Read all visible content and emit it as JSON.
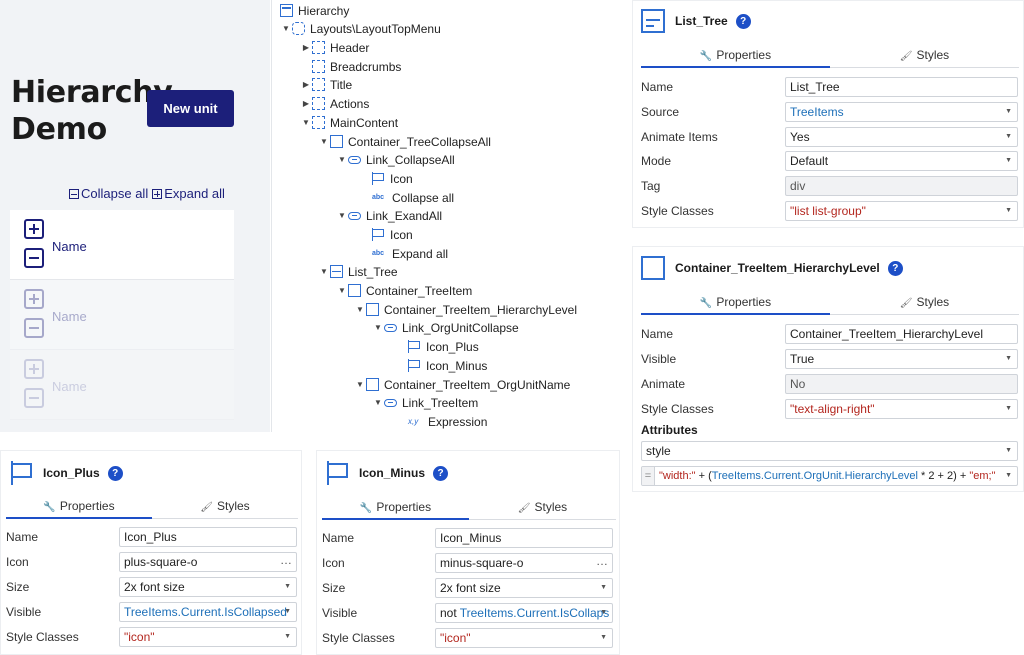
{
  "preview": {
    "title_line1": "Hierarchy",
    "title_line2": "Demo",
    "new_unit_label": "New unit",
    "collapse_all": "Collapse all",
    "expand_all": "Expand all",
    "rows": [
      {
        "name": "Name"
      },
      {
        "name": "Name"
      },
      {
        "name": "Name"
      }
    ]
  },
  "hierarchy": {
    "root": "Hierarchy",
    "nodes": [
      {
        "label": "Layouts\\LayoutTopMenu"
      },
      {
        "label": "Header"
      },
      {
        "label": "Breadcrumbs"
      },
      {
        "label": "Title"
      },
      {
        "label": "Actions"
      },
      {
        "label": "MainContent"
      },
      {
        "label": "Container_TreeCollapseAll"
      },
      {
        "label": "Link_CollapseAll"
      },
      {
        "label": "Icon"
      },
      {
        "label": "Collapse all"
      },
      {
        "label": "Link_ExandAll"
      },
      {
        "label": "Icon"
      },
      {
        "label": "Expand all"
      },
      {
        "label": "List_Tree"
      },
      {
        "label": "Container_TreeItem"
      },
      {
        "label": "Container_TreeItem_HierarchyLevel"
      },
      {
        "label": "Link_OrgUnitCollapse"
      },
      {
        "label": "Icon_Plus"
      },
      {
        "label": "Icon_Minus"
      },
      {
        "label": "Container_TreeItem_OrgUnitName"
      },
      {
        "label": "Link_TreeItem"
      },
      {
        "label": "Expression"
      }
    ]
  },
  "common": {
    "properties_tab": "Properties",
    "styles_tab": "Styles",
    "help": "?",
    "abc": "abc",
    "xy": "x,y"
  },
  "list_tree": {
    "title": "List_Tree",
    "labels": {
      "name": "Name",
      "source": "Source",
      "animate": "Animate Items",
      "mode": "Mode",
      "tag": "Tag",
      "style": "Style Classes"
    },
    "values": {
      "name": "List_Tree",
      "source": "TreeItems",
      "animate": "Yes",
      "mode": "Default",
      "tag": "div",
      "style": "\"list list-group\""
    }
  },
  "hier_level": {
    "title": "Container_TreeItem_HierarchyLevel",
    "labels": {
      "name": "Name",
      "visible": "Visible",
      "animate": "Animate",
      "style": "Style Classes"
    },
    "values": {
      "name": "Container_TreeItem_HierarchyLevel",
      "visible": "True",
      "animate": "No",
      "style": "\"text-align-right\""
    },
    "attributes_label": "Attributes",
    "attr_name": "style",
    "expr": {
      "s1": "\"width:\"",
      "k1": "+ (",
      "b1": "TreeItems.Current.OrgUnit.HierarchyLevel",
      "k2": "* 2 + 2) +",
      "s2": "\"em;\""
    }
  },
  "icon_plus": {
    "title": "Icon_Plus",
    "labels": {
      "name": "Name",
      "icon": "Icon",
      "size": "Size",
      "visible": "Visible",
      "style": "Style Classes"
    },
    "values": {
      "name": "Icon_Plus",
      "icon": "plus-square-o",
      "size": "2x font size",
      "visible": "TreeItems.Current.IsCollapsed",
      "style": "\"icon\""
    }
  },
  "icon_minus": {
    "title": "Icon_Minus",
    "labels": {
      "name": "Name",
      "icon": "Icon",
      "size": "Size",
      "visible": "Visible",
      "style": "Style Classes"
    },
    "values": {
      "name": "Icon_Minus",
      "icon": "minus-square-o",
      "size": "2x font size",
      "visible_prefix": "not",
      "visible": "TreeItems.Current.IsCollaps",
      "style": "\"icon\""
    }
  }
}
